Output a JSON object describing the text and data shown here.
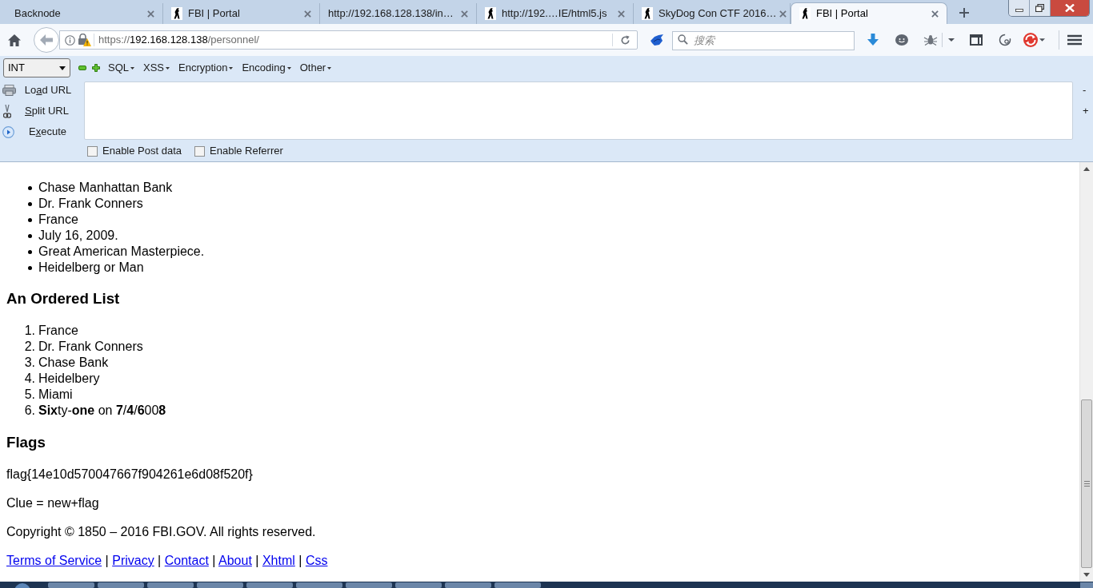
{
  "browser": {
    "tabs": [
      {
        "title": "Backnode",
        "favicon": false,
        "selected": false
      },
      {
        "title": "FBI | Portal",
        "favicon": true,
        "selected": false
      },
      {
        "title": "http://192.168.128.138/in…",
        "favicon": false,
        "selected": false
      },
      {
        "title": "http://192.…IE/html5.js",
        "favicon": true,
        "selected": false
      },
      {
        "title": "SkyDog Con CTF 2016…",
        "favicon": true,
        "selected": false
      },
      {
        "title": "FBI | Portal",
        "favicon": true,
        "selected": true
      }
    ],
    "address_bar": {
      "scheme": "https://",
      "host": "192.168.128.138",
      "path": "/personnel/"
    },
    "search": {
      "placeholder": "搜索"
    }
  },
  "hackbar": {
    "type_select": {
      "value": "INT"
    },
    "menus": [
      "SQL",
      "XSS",
      "Encryption",
      "Encoding",
      "Other"
    ],
    "actions": [
      {
        "kind": "load",
        "label_before": "Lo",
        "access_key": "a",
        "label_after": "d URL"
      },
      {
        "kind": "split",
        "access_key": "S",
        "label_after": "plit URL"
      },
      {
        "kind": "execute",
        "label_before": "E",
        "access_key": "x",
        "label_after": "ecute"
      }
    ],
    "side_buttons": [
      "-",
      "+"
    ],
    "checkboxes": [
      {
        "label": "Enable Post data",
        "checked": false
      },
      {
        "label": "Enable Referrer",
        "checked": false
      }
    ]
  },
  "page": {
    "unordered_list": [
      "Chase Manhattan Bank",
      "Dr. Frank Conners",
      "France",
      "July 16, 2009.",
      "Great American Masterpiece.",
      "Heidelberg or Man"
    ],
    "ordered_list_heading": "An Ordered List",
    "ordered_list": [
      {
        "number": "1.",
        "text": "France"
      },
      {
        "number": "2.",
        "text": "Dr. Frank Conners"
      },
      {
        "number": "3.",
        "text": "Chase Bank"
      },
      {
        "number": "4.",
        "text": "Heidelbery"
      },
      {
        "number": "5.",
        "text": "Miami"
      },
      {
        "number": "6.",
        "text": "**Six**ty-**one** on **7**/**4**/**6**00**8**"
      }
    ],
    "flags_heading": "Flags",
    "paragraphs": [
      "flag{14e10d570047667f904261e6d08f520f}",
      "Clue = new+flag",
      "Copyright © 1850 – 2016 FBI.GOV. All rights reserved."
    ],
    "footer": [
      {
        "kind": "link",
        "text": "Terms of Service"
      },
      {
        "kind": "separator",
        "text": "|"
      },
      {
        "kind": "link",
        "text": "Privacy"
      },
      {
        "kind": "separator",
        "text": "|"
      },
      {
        "kind": "link",
        "text": "Contact"
      },
      {
        "kind": "separator",
        "text": "|"
      },
      {
        "kind": "link",
        "text": "About"
      },
      {
        "kind": "separator",
        "text": "|"
      },
      {
        "kind": "link",
        "text": "Xhtml"
      },
      {
        "kind": "separator",
        "text": "|"
      },
      {
        "kind": "link",
        "text": "Css"
      }
    ]
  }
}
